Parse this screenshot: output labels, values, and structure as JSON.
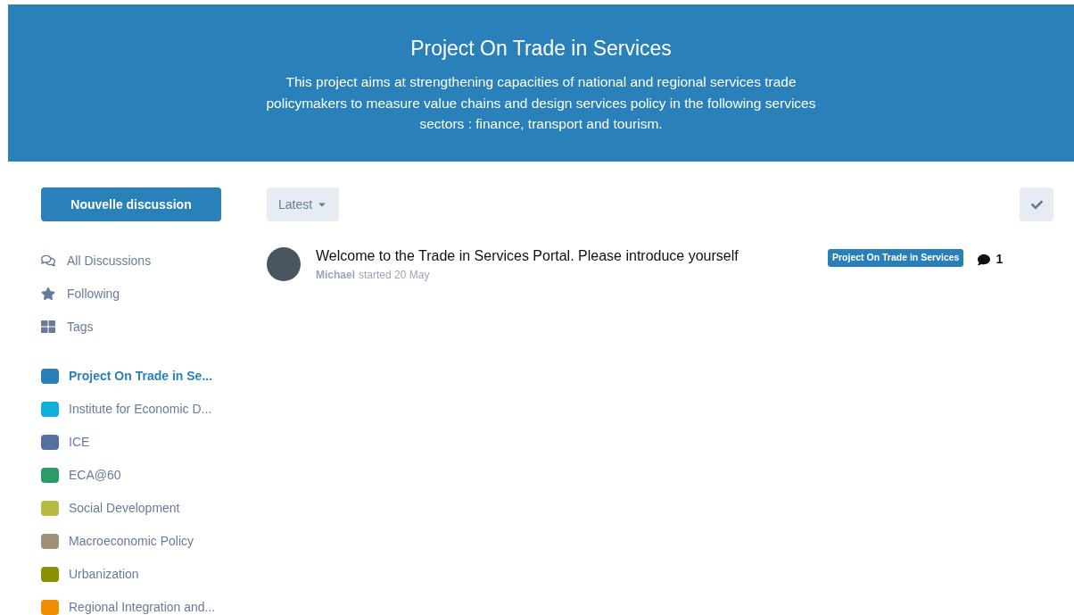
{
  "hero": {
    "title": "Project On Trade in Services",
    "description": "This project aims at strengthening capacities of national and regional services trade policymakers to measure value chains and design services policy in the following services sectors : finance, transport and tourism."
  },
  "sidebar": {
    "new_button": "Nouvelle discussion",
    "nav": [
      {
        "kind": "discussions",
        "label": "All Discussions",
        "selected": false
      },
      {
        "kind": "following",
        "label": "Following",
        "selected": false
      },
      {
        "kind": "tags",
        "label": "Tags",
        "selected": false
      }
    ],
    "tags": [
      {
        "label": "Project On Trade in Se...",
        "color": "#2980b9",
        "selected": true
      },
      {
        "label": "Institute for Economic D...",
        "color": "#0eb0db",
        "selected": false
      },
      {
        "label": "ICE",
        "color": "#5470a0",
        "selected": false
      },
      {
        "label": "ECA@60",
        "color": "#2e9a6a",
        "selected": false
      },
      {
        "label": "Social Development",
        "color": "#b6bb3e",
        "selected": false
      },
      {
        "label": "Macroeconomic Policy",
        "color": "#a09078",
        "selected": false
      },
      {
        "label": "Urbanization",
        "color": "#8a9000",
        "selected": false
      },
      {
        "label": "Regional Integration and...",
        "color": "#f08c00",
        "selected": false
      }
    ]
  },
  "toolbar": {
    "sort": "Latest"
  },
  "discussions": [
    {
      "title": "Welcome to the Trade in Services Portal. Please introduce yourself",
      "author": "Michael",
      "meta": "started 20 May",
      "tag": "Project On Trade in Services",
      "color": "#2980b9",
      "replies": "1"
    }
  ]
}
